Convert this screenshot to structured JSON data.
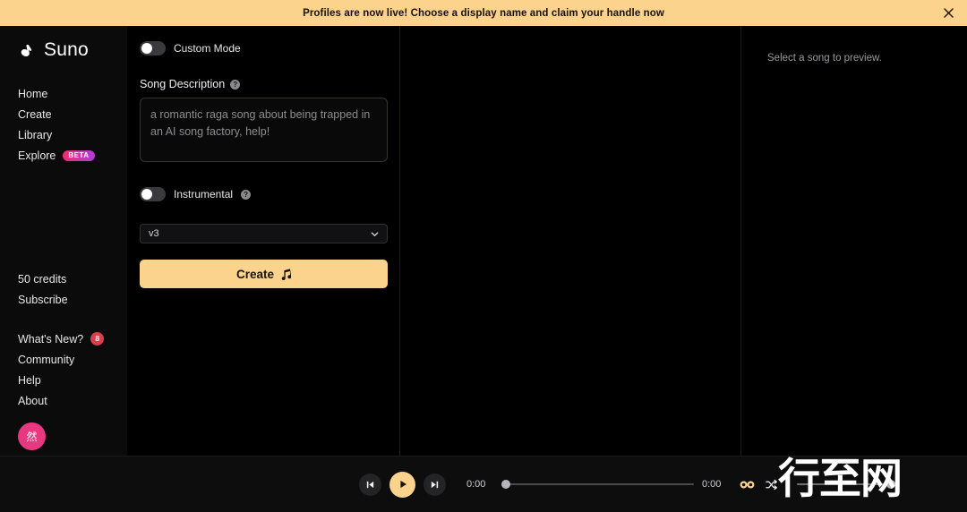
{
  "banner": {
    "text": "Profiles are now live! Choose a display name and claim your handle now",
    "close_icon": "close-icon",
    "bg_color": "#fbd38d"
  },
  "sidebar": {
    "brand": "Suno",
    "nav": [
      {
        "label": "Home"
      },
      {
        "label": "Create"
      },
      {
        "label": "Library"
      },
      {
        "label": "Explore",
        "badge": "BETA"
      }
    ],
    "credits": "50 credits",
    "subscribe": "Subscribe",
    "secondary": [
      {
        "label": "What's New?",
        "badge": "8"
      },
      {
        "label": "Community"
      },
      {
        "label": "Help"
      },
      {
        "label": "About"
      }
    ],
    "avatar_text": "然",
    "avatar_color": "#e8387f"
  },
  "create": {
    "custom_mode_label": "Custom Mode",
    "custom_mode_on": false,
    "song_description_label": "Song Description",
    "song_description_value": "a romantic raga song about being trapped in an AI song factory, help!",
    "song_description_placeholder": "a romantic raga song about being trapped in an AI song factory, help!",
    "instrumental_label": "Instrumental",
    "instrumental_on": false,
    "help_icon": "help-icon",
    "version_value": "v3",
    "version_options": [
      "v3"
    ],
    "create_label": "Create",
    "create_icon": "music-note-icon",
    "create_color": "#fbd38d"
  },
  "preview": {
    "empty_text": "Select a song to preview."
  },
  "player": {
    "previous_icon": "skip-previous-icon",
    "play_icon": "play-icon",
    "next_icon": "skip-next-icon",
    "elapsed_time": "0:00",
    "total_time": "0:00",
    "loop_icon": "infinity-icon",
    "shuffle_icon": "shuffle-icon",
    "accent_color": "#fbd38d"
  },
  "watermark": {
    "text": "行至网"
  }
}
